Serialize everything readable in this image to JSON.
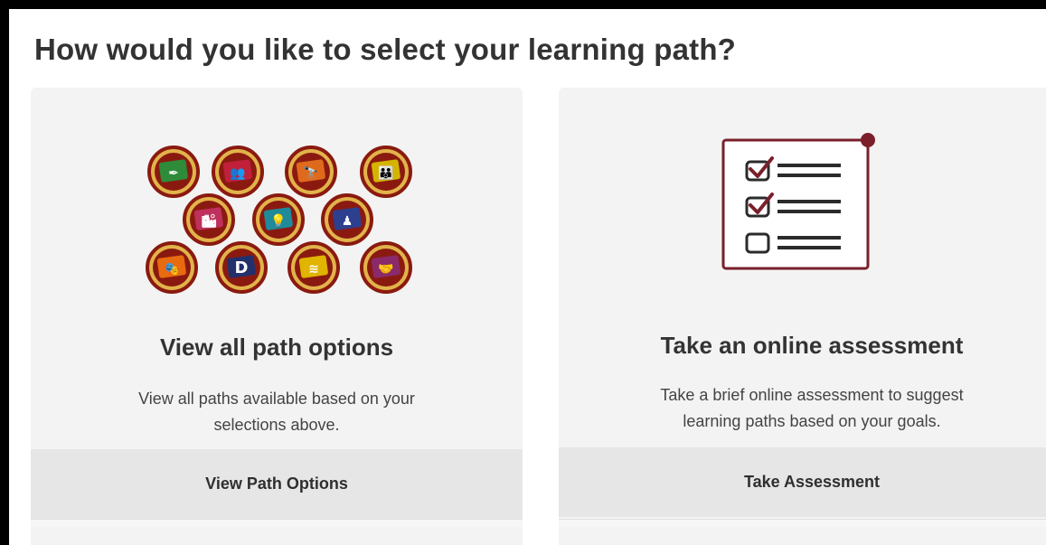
{
  "page": {
    "heading": "How would you like to select your learning path?"
  },
  "options": {
    "view_paths": {
      "title": "View all path options",
      "desc_line1": "View all paths available based on your",
      "desc_line2": "selections above.",
      "button_label": "View Path Options"
    },
    "assessment": {
      "title": "Take an online assessment",
      "desc_line1": "Take a brief online assessment to suggest",
      "desc_line2": "learning paths based on your goals.",
      "button_label": "Take Assessment"
    }
  },
  "badges": [
    {
      "name": "badge-green-pen-icon",
      "color": "#2e8b3a",
      "glyph": "✒"
    },
    {
      "name": "badge-red-people-icon",
      "color": "#c0203a",
      "glyph": "👥"
    },
    {
      "name": "badge-orange-telescope-icon",
      "color": "#e06a1c",
      "glyph": "🔭"
    },
    {
      "name": "badge-yellow-group-icon",
      "color": "#d4b400",
      "glyph": "👪"
    },
    {
      "name": "badge-pink-city-icon",
      "color": "#c0305c",
      "glyph": "🏙"
    },
    {
      "name": "badge-teal-bulb-icon",
      "color": "#1f8a9a",
      "glyph": "💡"
    },
    {
      "name": "badge-blue-chess-icon",
      "color": "#2d3f8f",
      "glyph": "♟"
    },
    {
      "name": "badge-orange-masks-icon",
      "color": "#e86b10",
      "glyph": "🎭"
    },
    {
      "name": "badge-navy-d-icon",
      "color": "#22306b",
      "glyph": "D"
    },
    {
      "name": "badge-yellow-stripes-icon",
      "color": "#e0b400",
      "glyph": "≋"
    },
    {
      "name": "badge-purple-handshake-icon",
      "color": "#8a2a6a",
      "glyph": "🤝"
    }
  ],
  "colors": {
    "accent": "#7a1f2b",
    "badge_ring": "#8a1a10",
    "card_bg": "#f3f3f3",
    "button_bg": "#e6e6e6"
  }
}
